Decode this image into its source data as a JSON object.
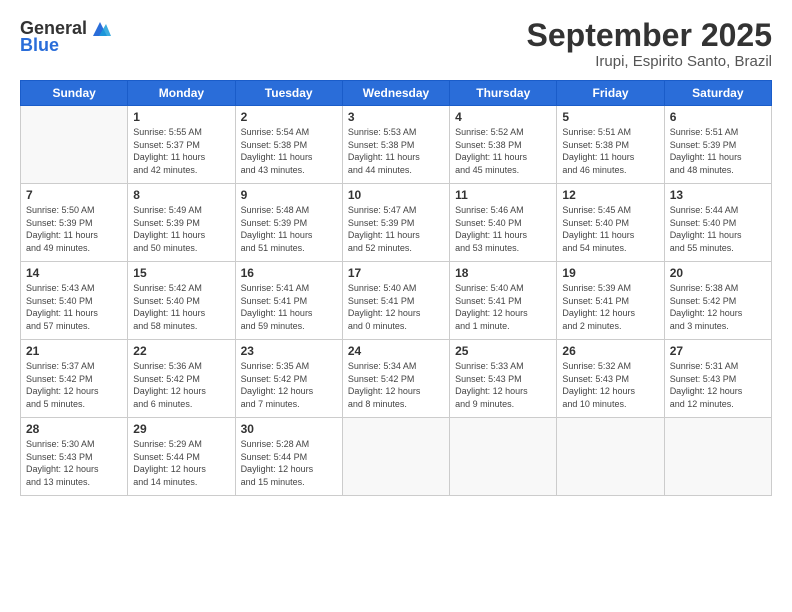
{
  "header": {
    "logo_general": "General",
    "logo_blue": "Blue",
    "month_title": "September 2025",
    "subtitle": "Irupi, Espirito Santo, Brazil"
  },
  "weekdays": [
    "Sunday",
    "Monday",
    "Tuesday",
    "Wednesday",
    "Thursday",
    "Friday",
    "Saturday"
  ],
  "weeks": [
    [
      {
        "day": "",
        "info": ""
      },
      {
        "day": "1",
        "info": "Sunrise: 5:55 AM\nSunset: 5:37 PM\nDaylight: 11 hours\nand 42 minutes."
      },
      {
        "day": "2",
        "info": "Sunrise: 5:54 AM\nSunset: 5:38 PM\nDaylight: 11 hours\nand 43 minutes."
      },
      {
        "day": "3",
        "info": "Sunrise: 5:53 AM\nSunset: 5:38 PM\nDaylight: 11 hours\nand 44 minutes."
      },
      {
        "day": "4",
        "info": "Sunrise: 5:52 AM\nSunset: 5:38 PM\nDaylight: 11 hours\nand 45 minutes."
      },
      {
        "day": "5",
        "info": "Sunrise: 5:51 AM\nSunset: 5:38 PM\nDaylight: 11 hours\nand 46 minutes."
      },
      {
        "day": "6",
        "info": "Sunrise: 5:51 AM\nSunset: 5:39 PM\nDaylight: 11 hours\nand 48 minutes."
      }
    ],
    [
      {
        "day": "7",
        "info": "Sunrise: 5:50 AM\nSunset: 5:39 PM\nDaylight: 11 hours\nand 49 minutes."
      },
      {
        "day": "8",
        "info": "Sunrise: 5:49 AM\nSunset: 5:39 PM\nDaylight: 11 hours\nand 50 minutes."
      },
      {
        "day": "9",
        "info": "Sunrise: 5:48 AM\nSunset: 5:39 PM\nDaylight: 11 hours\nand 51 minutes."
      },
      {
        "day": "10",
        "info": "Sunrise: 5:47 AM\nSunset: 5:39 PM\nDaylight: 11 hours\nand 52 minutes."
      },
      {
        "day": "11",
        "info": "Sunrise: 5:46 AM\nSunset: 5:40 PM\nDaylight: 11 hours\nand 53 minutes."
      },
      {
        "day": "12",
        "info": "Sunrise: 5:45 AM\nSunset: 5:40 PM\nDaylight: 11 hours\nand 54 minutes."
      },
      {
        "day": "13",
        "info": "Sunrise: 5:44 AM\nSunset: 5:40 PM\nDaylight: 11 hours\nand 55 minutes."
      }
    ],
    [
      {
        "day": "14",
        "info": "Sunrise: 5:43 AM\nSunset: 5:40 PM\nDaylight: 11 hours\nand 57 minutes."
      },
      {
        "day": "15",
        "info": "Sunrise: 5:42 AM\nSunset: 5:40 PM\nDaylight: 11 hours\nand 58 minutes."
      },
      {
        "day": "16",
        "info": "Sunrise: 5:41 AM\nSunset: 5:41 PM\nDaylight: 11 hours\nand 59 minutes."
      },
      {
        "day": "17",
        "info": "Sunrise: 5:40 AM\nSunset: 5:41 PM\nDaylight: 12 hours\nand 0 minutes."
      },
      {
        "day": "18",
        "info": "Sunrise: 5:40 AM\nSunset: 5:41 PM\nDaylight: 12 hours\nand 1 minute."
      },
      {
        "day": "19",
        "info": "Sunrise: 5:39 AM\nSunset: 5:41 PM\nDaylight: 12 hours\nand 2 minutes."
      },
      {
        "day": "20",
        "info": "Sunrise: 5:38 AM\nSunset: 5:42 PM\nDaylight: 12 hours\nand 3 minutes."
      }
    ],
    [
      {
        "day": "21",
        "info": "Sunrise: 5:37 AM\nSunset: 5:42 PM\nDaylight: 12 hours\nand 5 minutes."
      },
      {
        "day": "22",
        "info": "Sunrise: 5:36 AM\nSunset: 5:42 PM\nDaylight: 12 hours\nand 6 minutes."
      },
      {
        "day": "23",
        "info": "Sunrise: 5:35 AM\nSunset: 5:42 PM\nDaylight: 12 hours\nand 7 minutes."
      },
      {
        "day": "24",
        "info": "Sunrise: 5:34 AM\nSunset: 5:42 PM\nDaylight: 12 hours\nand 8 minutes."
      },
      {
        "day": "25",
        "info": "Sunrise: 5:33 AM\nSunset: 5:43 PM\nDaylight: 12 hours\nand 9 minutes."
      },
      {
        "day": "26",
        "info": "Sunrise: 5:32 AM\nSunset: 5:43 PM\nDaylight: 12 hours\nand 10 minutes."
      },
      {
        "day": "27",
        "info": "Sunrise: 5:31 AM\nSunset: 5:43 PM\nDaylight: 12 hours\nand 12 minutes."
      }
    ],
    [
      {
        "day": "28",
        "info": "Sunrise: 5:30 AM\nSunset: 5:43 PM\nDaylight: 12 hours\nand 13 minutes."
      },
      {
        "day": "29",
        "info": "Sunrise: 5:29 AM\nSunset: 5:44 PM\nDaylight: 12 hours\nand 14 minutes."
      },
      {
        "day": "30",
        "info": "Sunrise: 5:28 AM\nSunset: 5:44 PM\nDaylight: 12 hours\nand 15 minutes."
      },
      {
        "day": "",
        "info": ""
      },
      {
        "day": "",
        "info": ""
      },
      {
        "day": "",
        "info": ""
      },
      {
        "day": "",
        "info": ""
      }
    ]
  ]
}
